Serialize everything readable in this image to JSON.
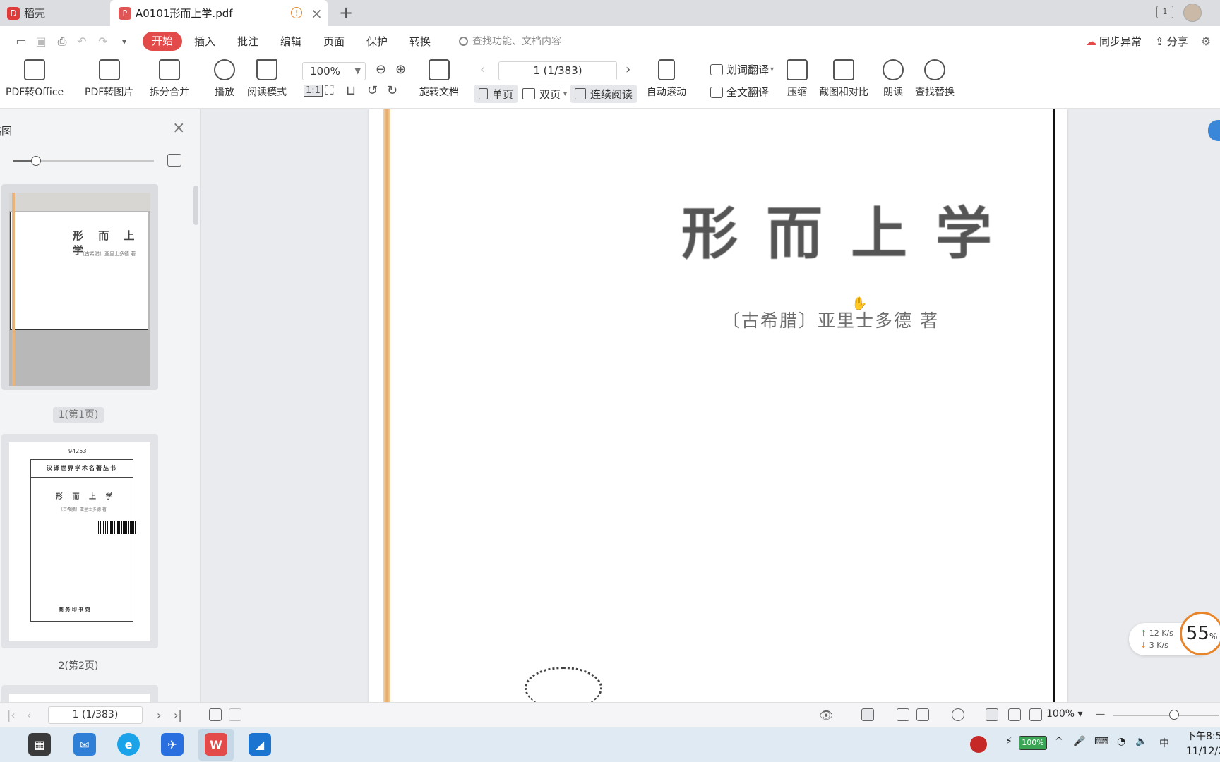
{
  "tabs": {
    "home_label": "稻壳",
    "doc_label": "A0101形而上学.pdf"
  },
  "menu": {
    "items": [
      "开始",
      "插入",
      "批注",
      "编辑",
      "页面",
      "保护",
      "转换"
    ],
    "search_placeholder": "查找功能、文档内容",
    "sync_label": "同步异常",
    "share_label": "分享"
  },
  "ribbon": {
    "pdf_to_office": "PDF转Office",
    "pdf_to_image": "PDF转图片",
    "split_merge": "拆分合并",
    "play": "播放",
    "read_mode": "阅读模式",
    "zoom_value": "100%",
    "rotate_doc": "旋转文档",
    "page_indicator": "1 (1/383)",
    "single_page": "单页",
    "double_page": "双页",
    "continuous": "连续阅读",
    "auto_scroll": "自动滚动",
    "word_translate": "划词翻译",
    "full_translate": "全文翻译",
    "compress": "压缩",
    "screenshot_compare": "截图和对比",
    "read_aloud": "朗读",
    "find_replace": "查找替换"
  },
  "sidebar": {
    "title": "缩略图",
    "thumbnails": [
      {
        "label": "1(第1页)",
        "title": "形 而 上 学",
        "subtitle": "〔古希腊〕亚里士多德 著"
      },
      {
        "label": "2(第2页)",
        "title": "形 而 上 学",
        "series": "汉译世界学术名著丛书",
        "subtitle": "〔古希腊〕亚里士多德 著",
        "catalog_no": "94253",
        "publisher": "商 务 印 书 馆"
      }
    ]
  },
  "document": {
    "title": "形而上学",
    "author_line": "〔古希腊〕亚里士多德 著"
  },
  "net_widget": {
    "up": "12",
    "down": "3",
    "unit": "K/s",
    "percent": "55",
    "percent_sign": "%"
  },
  "statusbar": {
    "page_indicator": "1 (1/383)",
    "zoom_value": "100%"
  },
  "taskbar": {
    "battery": "100%",
    "ime": "中",
    "time": "下午8:5",
    "date": "11/12/2"
  },
  "colors": {
    "accent_red": "#e34b4b",
    "pdf_orange_edge": "#e6a964",
    "net_up_green": "#3aa655",
    "net_down_orange": "#e8852b"
  }
}
